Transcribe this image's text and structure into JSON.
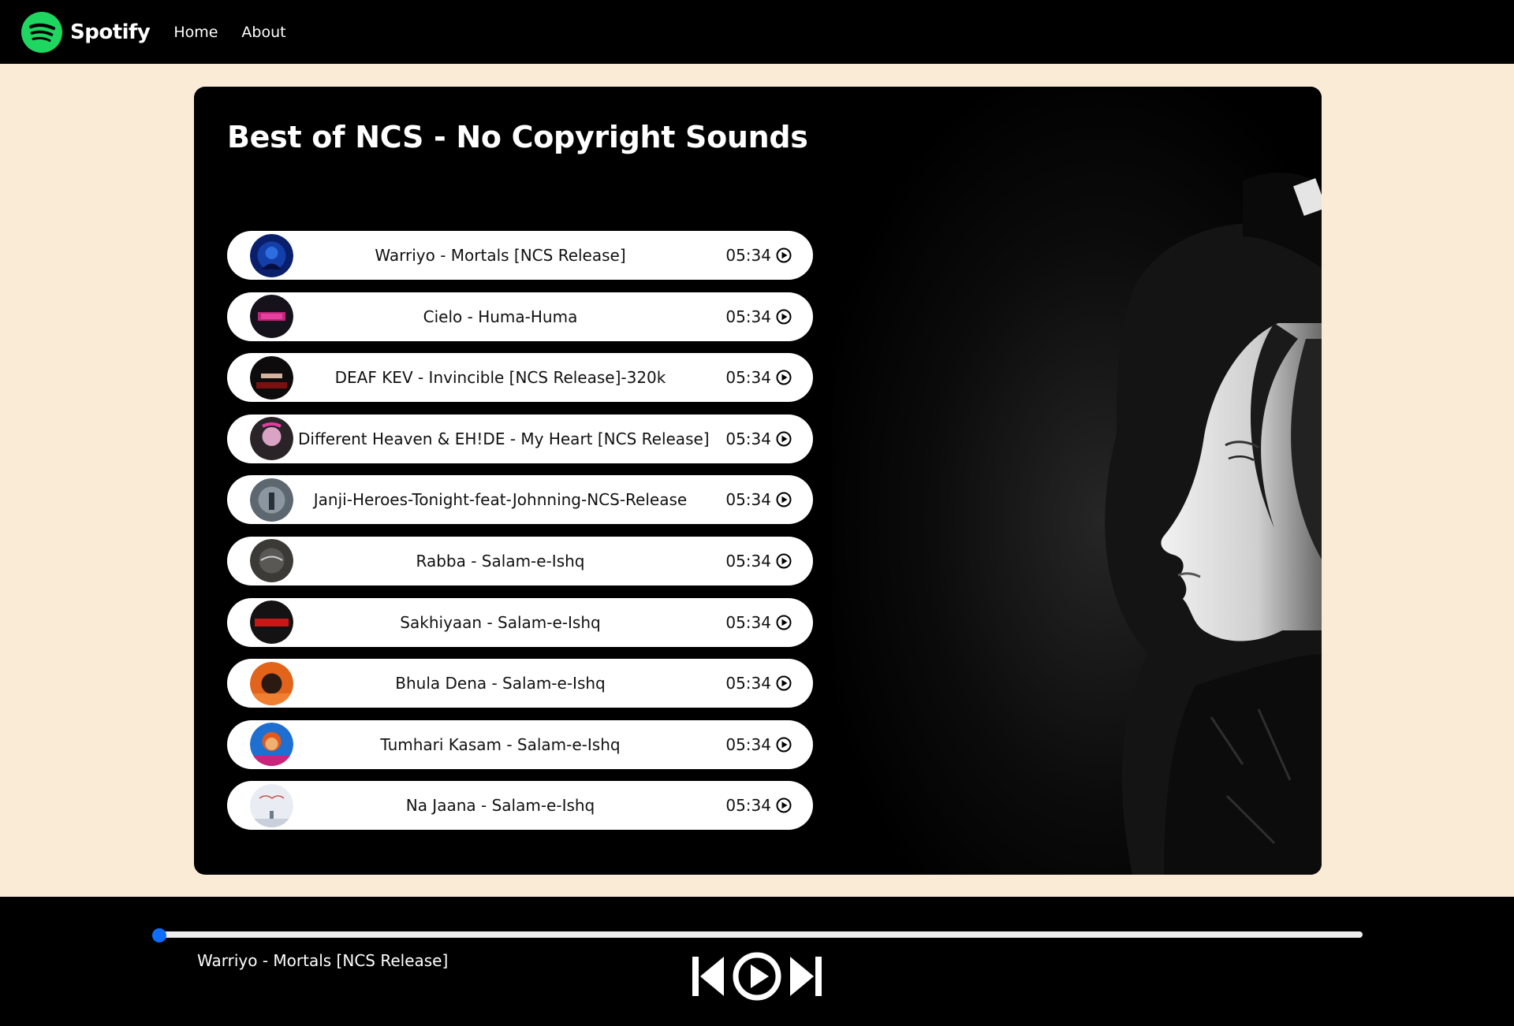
{
  "nav": {
    "brand": "Spotify",
    "links": [
      "Home",
      "About"
    ]
  },
  "playlist": {
    "title": "Best of NCS - No Copyright Sounds",
    "songs": [
      {
        "name": "Warriyo - Mortals [NCS Release]",
        "duration": "05:34"
      },
      {
        "name": "Cielo - Huma-Huma",
        "duration": "05:34"
      },
      {
        "name": "DEAF KEV - Invincible [NCS Release]-320k",
        "duration": "05:34"
      },
      {
        "name": "Different Heaven & EH!DE - My Heart [NCS Release]",
        "duration": "05:34"
      },
      {
        "name": "Janji-Heroes-Tonight-feat-Johnning-NCS-Release",
        "duration": "05:34"
      },
      {
        "name": "Rabba - Salam-e-Ishq",
        "duration": "05:34"
      },
      {
        "name": "Sakhiyaan - Salam-e-Ishq",
        "duration": "05:34"
      },
      {
        "name": "Bhula Dena - Salam-e-Ishq",
        "duration": "05:34"
      },
      {
        "name": "Tumhari Kasam - Salam-e-Ishq",
        "duration": "05:34"
      },
      {
        "name": "Na Jaana - Salam-e-Ishq",
        "duration": "05:34"
      }
    ]
  },
  "player": {
    "now_playing": "Warriyo - Mortals [NCS Release]",
    "progress": 0
  },
  "colors": {
    "page_bg": "#faebd7",
    "accent": "#1ed760",
    "progress_thumb": "#0d6efd"
  },
  "icons": [
    "spotify-logo-icon",
    "play-circle-icon",
    "previous-icon",
    "play-icon",
    "next-icon"
  ]
}
